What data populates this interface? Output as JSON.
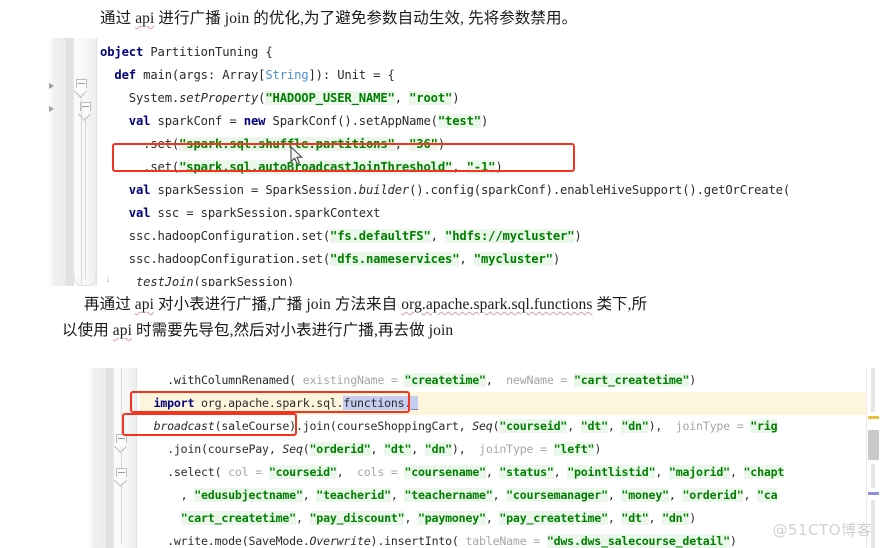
{
  "document": {
    "watermark": "@51CTO博客",
    "paragraph_1": "通过 api 进行广播 join 的优化,为了避免参数自动生效, 先将参数禁用。",
    "paragraph_1_parts": {
      "a": "通过 ",
      "api": "api",
      "b": " 进行广播 join 的优化,为了避免参数自动生效, 先将参数禁用。"
    },
    "paragraph_2_line1_parts": {
      "a": "再通过 ",
      "api": "api",
      "b": " 对小表进行广播,广播 join 方法来自 ",
      "pkg": "org.apache.spark.sql.functions",
      "c": " 类下,所"
    },
    "paragraph_2_line2_parts": {
      "a": "以使用 ",
      "api": "api",
      "b": " 时需要先导包,然后对小表进行广播,再去做 join"
    }
  },
  "colors": {
    "keyword": "#00007f",
    "string": "#008000",
    "string_bg": "#eaf7ea",
    "type": "#4a90d9",
    "named_arg": "#a6a6a6",
    "annotation_box": "#f5341f",
    "highlight_line": "#fdf6dd",
    "selection": "#c5cdf0",
    "scroll_mark_yellow": "#e8c13a",
    "scroll_mark_purple": "#8d8ddc",
    "watermark": "#d2d2d2"
  },
  "editor_1": {
    "gutter_number": "1",
    "lines": [
      {
        "id": "e1-l1",
        "text": "object PartitionTuning {",
        "tokens": [
          {
            "t": "object",
            "c": "kw"
          },
          {
            "t": " PartitionTuning {",
            "c": "plain"
          }
        ]
      },
      {
        "id": "e1-l2",
        "text": "  def main(args: Array[String]): Unit = {",
        "tokens": [
          {
            "t": "  ",
            "c": "plain"
          },
          {
            "t": "def",
            "c": "kw"
          },
          {
            "t": " main(args: Array[",
            "c": "plain"
          },
          {
            "t": "String",
            "c": "typ"
          },
          {
            "t": "]): Unit = {",
            "c": "plain"
          }
        ]
      },
      {
        "id": "e1-l3",
        "text": "    System.setProperty(\"HADOOP_USER_NAME\", \"root\")",
        "tokens": [
          {
            "t": "    System.",
            "c": "plain"
          },
          {
            "t": "setProperty",
            "c": "ital"
          },
          {
            "t": "(",
            "c": "plain"
          },
          {
            "t": "\"HADOOP_USER_NAME\"",
            "c": "str"
          },
          {
            "t": ", ",
            "c": "plain"
          },
          {
            "t": "\"root\"",
            "c": "str"
          },
          {
            "t": ")",
            "c": "plain"
          }
        ]
      },
      {
        "id": "e1-l4",
        "text": "    val sparkConf = new SparkConf().setAppName(\"test\")",
        "tokens": [
          {
            "t": "    ",
            "c": "plain"
          },
          {
            "t": "val",
            "c": "kw"
          },
          {
            "t": " sparkConf = ",
            "c": "plain"
          },
          {
            "t": "new",
            "c": "kw"
          },
          {
            "t": " SparkConf().setAppName(",
            "c": "plain"
          },
          {
            "t": "\"test\"",
            "c": "str"
          },
          {
            "t": ")",
            "c": "plain"
          }
        ]
      },
      {
        "id": "e1-l5",
        "text": "      .set(\"spark.sql.shuffle.partitions\", \"36\")",
        "tokens": [
          {
            "t": "      .set(",
            "c": "plain"
          },
          {
            "t": "\"spark.sql.shuffle.partitions\"",
            "c": "str"
          },
          {
            "t": ", ",
            "c": "plain"
          },
          {
            "t": "\"36\"",
            "c": "str"
          },
          {
            "t": ")",
            "c": "plain"
          }
        ]
      },
      {
        "id": "e1-l6",
        "text": "      .set(\"spark.sql.autoBroadcastJoinThreshold\", \"-1\")",
        "tokens": [
          {
            "t": "      .set(",
            "c": "plain"
          },
          {
            "t": "\"spark.sql.autoBroadcastJoinThreshold\"",
            "c": "str"
          },
          {
            "t": ", ",
            "c": "plain"
          },
          {
            "t": "\"-1\"",
            "c": "str"
          },
          {
            "t": ")",
            "c": "plain"
          }
        ]
      },
      {
        "id": "e1-l7",
        "text": "    val sparkSession = SparkSession.builder().config(sparkConf).enableHiveSupport().getOrCreate()",
        "tokens": [
          {
            "t": "    ",
            "c": "plain"
          },
          {
            "t": "val",
            "c": "kw"
          },
          {
            "t": " sparkSession = SparkSession.",
            "c": "plain"
          },
          {
            "t": "builder",
            "c": "ital"
          },
          {
            "t": "().config(sparkConf).enableHiveSupport().getOrCreate()",
            "c": "plain"
          }
        ]
      },
      {
        "id": "e1-l8",
        "text": "    val ssc = sparkSession.sparkContext",
        "tokens": [
          {
            "t": "    ",
            "c": "plain"
          },
          {
            "t": "val",
            "c": "kw"
          },
          {
            "t": " ssc = sparkSession.sparkContext",
            "c": "plain"
          }
        ]
      },
      {
        "id": "e1-l9",
        "text": "    ssc.hadoopConfiguration.set(\"fs.defaultFS\", \"hdfs://mycluster\")",
        "tokens": [
          {
            "t": "    ssc.hadoopConfiguration.set(",
            "c": "plain"
          },
          {
            "t": "\"fs.defaultFS\"",
            "c": "str"
          },
          {
            "t": ", ",
            "c": "plain"
          },
          {
            "t": "\"hdfs://mycluster\"",
            "c": "str"
          },
          {
            "t": ")",
            "c": "plain"
          }
        ]
      },
      {
        "id": "e1-l10",
        "text": "    ssc.hadoopConfiguration.set(\"dfs.nameservices\", \"mycluster\")",
        "tokens": [
          {
            "t": "    ssc.hadoopConfiguration.set(",
            "c": "plain"
          },
          {
            "t": "\"dfs.nameservices\"",
            "c": "str"
          },
          {
            "t": ", ",
            "c": "plain"
          },
          {
            "t": "\"mycluster\"",
            "c": "str"
          },
          {
            "t": ")",
            "c": "plain"
          }
        ]
      },
      {
        "id": "e1-l11",
        "text": "     testJoin(sparkSession)",
        "tokens": [
          {
            "t": "     ",
            "c": "plain"
          },
          {
            "t": "testJoin",
            "c": "ital"
          },
          {
            "t": "(sparkSession)",
            "c": "plain"
          }
        ]
      }
    ]
  },
  "editor_2": {
    "lines": [
      {
        "id": "e2-l1",
        "highlight": false,
        "text": "    .withColumnRenamed( existingName = \"createtime\",  newName = \"cart_createtime\")",
        "tokens": [
          {
            "t": "    .withColumnRenamed(",
            "c": "plain"
          },
          {
            "t": " existingName = ",
            "c": "named"
          },
          {
            "t": "\"createtime\"",
            "c": "str"
          },
          {
            "t": ", ",
            "c": "plain"
          },
          {
            "t": " newName = ",
            "c": "named"
          },
          {
            "t": "\"cart_createtime\"",
            "c": "str"
          },
          {
            "t": ")",
            "c": "plain"
          }
        ]
      },
      {
        "id": "e2-l2",
        "highlight": true,
        "text": "  import org.apache.spark.sql.functions._",
        "tokens": [
          {
            "t": "  ",
            "c": "plain"
          },
          {
            "t": "import",
            "c": "kw"
          },
          {
            "t": " org.apache.spark.sql.",
            "c": "plain"
          },
          {
            "t": "functions._",
            "c": "sel"
          }
        ]
      },
      {
        "id": "e2-l3",
        "highlight": false,
        "text": "  broadcast(saleCourse).join(courseShoppingCart, Seq(\"courseid\", \"dt\", \"dn\"), joinType = \"rig",
        "tokens": [
          {
            "t": "  ",
            "c": "plain"
          },
          {
            "t": "broadcast",
            "c": "ital"
          },
          {
            "t": "(saleCourse).join(courseShoppingCart, ",
            "c": "plain"
          },
          {
            "t": "Seq",
            "c": "ital"
          },
          {
            "t": "(",
            "c": "plain"
          },
          {
            "t": "\"courseid\"",
            "c": "str"
          },
          {
            "t": ", ",
            "c": "plain"
          },
          {
            "t": "\"dt\"",
            "c": "str"
          },
          {
            "t": ", ",
            "c": "plain"
          },
          {
            "t": "\"dn\"",
            "c": "str"
          },
          {
            "t": "), ",
            "c": "plain"
          },
          {
            "t": " joinType = ",
            "c": "named"
          },
          {
            "t": "\"rig",
            "c": "str"
          }
        ]
      },
      {
        "id": "e2-l4",
        "highlight": false,
        "text": "    .join(coursePay, Seq(\"orderid\", \"dt\", \"dn\"),  joinType = \"left\")",
        "tokens": [
          {
            "t": "    .join(coursePay, ",
            "c": "plain"
          },
          {
            "t": "Seq",
            "c": "ital"
          },
          {
            "t": "(",
            "c": "plain"
          },
          {
            "t": "\"orderid\"",
            "c": "str"
          },
          {
            "t": ", ",
            "c": "plain"
          },
          {
            "t": "\"dt\"",
            "c": "str"
          },
          {
            "t": ", ",
            "c": "plain"
          },
          {
            "t": "\"dn\"",
            "c": "str"
          },
          {
            "t": "), ",
            "c": "plain"
          },
          {
            "t": " joinType = ",
            "c": "named"
          },
          {
            "t": "\"left\"",
            "c": "str"
          },
          {
            "t": ")",
            "c": "plain"
          }
        ]
      },
      {
        "id": "e2-l5",
        "highlight": false,
        "text": "    .select( col = \"courseid\",  cols = \"coursename\", \"status\", \"pointlistid\", \"majorid\", \"chapt",
        "tokens": [
          {
            "t": "    .select(",
            "c": "plain"
          },
          {
            "t": " col = ",
            "c": "named"
          },
          {
            "t": "\"courseid\"",
            "c": "str"
          },
          {
            "t": ", ",
            "c": "plain"
          },
          {
            "t": " cols = ",
            "c": "named"
          },
          {
            "t": "\"coursename\"",
            "c": "str"
          },
          {
            "t": ", ",
            "c": "plain"
          },
          {
            "t": "\"status\"",
            "c": "str"
          },
          {
            "t": ", ",
            "c": "plain"
          },
          {
            "t": "\"pointlistid\"",
            "c": "str"
          },
          {
            "t": ", ",
            "c": "plain"
          },
          {
            "t": "\"majorid\"",
            "c": "str"
          },
          {
            "t": ", ",
            "c": "plain"
          },
          {
            "t": "\"chapt",
            "c": "str"
          }
        ]
      },
      {
        "id": "e2-l6",
        "highlight": false,
        "text": "      , \"edusubjectname\", \"teacherid\", \"teachername\", \"coursemanager\", \"money\", \"orderid\", \"ca",
        "tokens": [
          {
            "t": "      , ",
            "c": "plain"
          },
          {
            "t": "\"edusubjectname\"",
            "c": "str"
          },
          {
            "t": ", ",
            "c": "plain"
          },
          {
            "t": "\"teacherid\"",
            "c": "str"
          },
          {
            "t": ", ",
            "c": "plain"
          },
          {
            "t": "\"teachername\"",
            "c": "str"
          },
          {
            "t": ", ",
            "c": "plain"
          },
          {
            "t": "\"coursemanager\"",
            "c": "str"
          },
          {
            "t": ", ",
            "c": "plain"
          },
          {
            "t": "\"money\"",
            "c": "str"
          },
          {
            "t": ", ",
            "c": "plain"
          },
          {
            "t": "\"orderid\"",
            "c": "str"
          },
          {
            "t": ", ",
            "c": "plain"
          },
          {
            "t": "\"ca",
            "c": "str"
          }
        ]
      },
      {
        "id": "e2-l7",
        "highlight": false,
        "text": "      \"cart_createtime\", \"pay_discount\", \"paymoney\", \"pay_createtime\", \"dt\", \"dn\")",
        "tokens": [
          {
            "t": "      ",
            "c": "plain"
          },
          {
            "t": "\"cart_createtime\"",
            "c": "str"
          },
          {
            "t": ", ",
            "c": "plain"
          },
          {
            "t": "\"pay_discount\"",
            "c": "str"
          },
          {
            "t": ", ",
            "c": "plain"
          },
          {
            "t": "\"paymoney\"",
            "c": "str"
          },
          {
            "t": ", ",
            "c": "plain"
          },
          {
            "t": "\"pay_createtime\"",
            "c": "str"
          },
          {
            "t": ", ",
            "c": "plain"
          },
          {
            "t": "\"dt\"",
            "c": "str"
          },
          {
            "t": ", ",
            "c": "plain"
          },
          {
            "t": "\"dn\"",
            "c": "str"
          },
          {
            "t": ")",
            "c": "plain"
          }
        ]
      },
      {
        "id": "e2-l8",
        "highlight": false,
        "text": "    .write.mode(SaveMode.Overwrite).insertInto( tableName = \"dws.dws_salecourse_detail\")",
        "tokens": [
          {
            "t": "    .write.mode(SaveMode.",
            "c": "plain"
          },
          {
            "t": "Overwrite",
            "c": "ital"
          },
          {
            "t": ").insertInto(",
            "c": "plain"
          },
          {
            "t": " tableName = ",
            "c": "named"
          },
          {
            "t": "\"dws.dws_salecourse_detail\"",
            "c": "str"
          },
          {
            "t": ")",
            "c": "plain"
          }
        ]
      }
    ]
  },
  "annotations": [
    {
      "name": "redbox-autobroadcast",
      "target": "spark.sql.autoBroadcastJoinThreshold line"
    },
    {
      "name": "redbox-import",
      "target": "import org.apache.spark.sql.functions._"
    },
    {
      "name": "redbox-broadcast",
      "target": "broadcast(saleCourse)"
    }
  ]
}
